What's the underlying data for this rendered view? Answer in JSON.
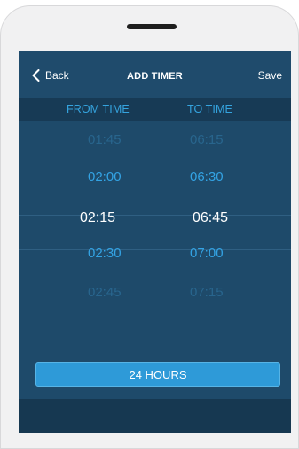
{
  "header": {
    "back_label": "Back",
    "title": "ADD TIMER",
    "save_label": "Save"
  },
  "columns": {
    "from_label": "FROM TIME",
    "to_label": "TO TIME"
  },
  "picker": {
    "from_times": [
      "01:45",
      "02:00",
      "02:15",
      "02:30",
      "02:45"
    ],
    "to_times": [
      "06:15",
      "06:30",
      "06:45",
      "07:00",
      "07:15"
    ],
    "selected_from": "02:15",
    "selected_to": "06:45"
  },
  "actions": {
    "hours_label": "24 HOURS"
  },
  "colors": {
    "screen_bg": "#1e4a6a",
    "accent": "#2e9ad8",
    "header_text": "#35a4df"
  },
  "icons": {
    "back": "chevron-left-icon"
  }
}
